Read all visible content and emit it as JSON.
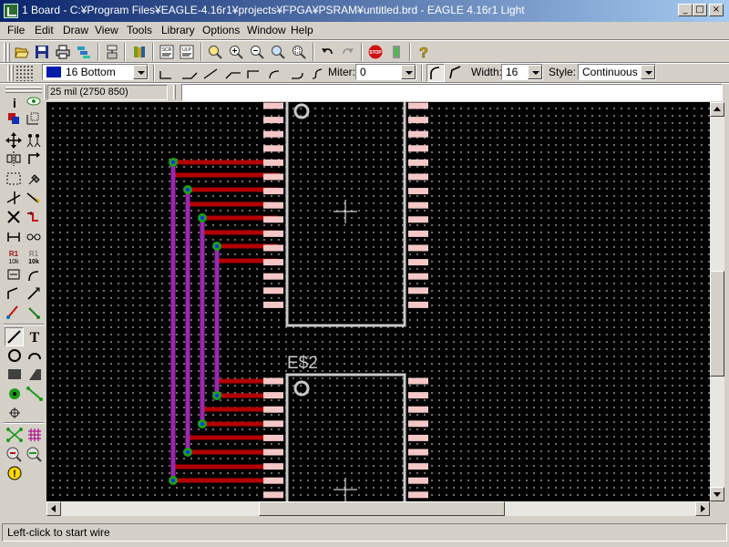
{
  "window": {
    "title": "1 Board - C:¥Program Files¥EAGLE-4.16r1¥projects¥FPGA¥PSRAM¥untitled.brd - EAGLE 4.16r1 Light",
    "controls": {
      "minimize": "_",
      "maximize": "□",
      "close": "×"
    }
  },
  "menu": {
    "items": [
      {
        "label": "File",
        "key": "F"
      },
      {
        "label": "Edit",
        "key": "E"
      },
      {
        "label": "Draw",
        "key": "D"
      },
      {
        "label": "View",
        "key": "V"
      },
      {
        "label": "Tools",
        "key": "T"
      },
      {
        "label": "Library",
        "key": "L"
      },
      {
        "label": "Options",
        "key": "O"
      },
      {
        "label": "Window",
        "key": "W"
      },
      {
        "label": "Help",
        "key": "H"
      }
    ]
  },
  "toolbar": {
    "icons": [
      "open-icon",
      "save-icon",
      "print-icon",
      "cam-icon",
      "board-schematic-icon",
      "library-icon",
      "script-icon",
      "ulp-icon",
      "zoom-fit-icon",
      "zoom-in-icon",
      "zoom-out-icon",
      "zoom-redraw-icon",
      "zoom-select-icon",
      "undo-icon",
      "redo-icon",
      "stop-icon",
      "go-icon",
      "help-icon"
    ],
    "stop_text": "STOP"
  },
  "params": {
    "layer": {
      "value": "16 Bottom",
      "color": "#001ca8"
    },
    "miter_label": "Miter:",
    "miter_value": "0",
    "width_label": "Width:",
    "width_value": "16",
    "style_label": "Style:",
    "style_value": "Continuous"
  },
  "coord": {
    "value": "25 mil (2750 850)"
  },
  "command": {
    "value": ""
  },
  "palette": {
    "tools": [
      "info-icon",
      "show-icon",
      "display-icon",
      "mark-icon",
      "move-icon",
      "copy-icon",
      "mirror-icon",
      "rotate-icon",
      "group-icon",
      "change-icon",
      "split-icon",
      "miter-icon",
      "delete-icon",
      "optimize-icon",
      "smash-icon",
      "pinswap-icon",
      "name-icon",
      "value-icon",
      "replace-icon",
      "arc-bend-icon",
      "route-icon",
      "ripup-icon",
      "wire-icon",
      "text-icon",
      "circle-icon",
      "arc-icon",
      "rect-icon",
      "polygon-icon",
      "via-icon",
      "signal-icon",
      "hole-icon",
      "ratsnest-icon",
      "auto-icon",
      "drc-icon",
      "erc-icon",
      "errors-icon"
    ],
    "r_label": "R1",
    "r_value": "10k"
  },
  "board": {
    "part_label": "E$2",
    "colors": {
      "top": "#b20000",
      "bottom": "#9c27b0",
      "pad": "#f4c7c7",
      "outline": "#c8c8c8",
      "via": "#1aa01a"
    }
  },
  "status": {
    "text": "Left-click to start wire"
  }
}
